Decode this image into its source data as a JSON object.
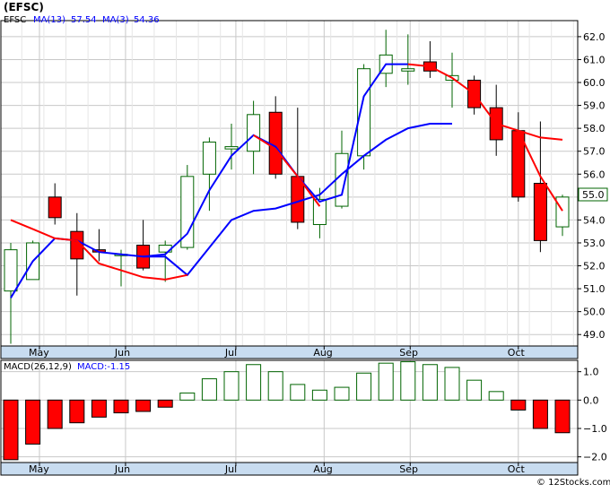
{
  "title": "(EFSC)",
  "watermark": "© 12Stocks.com",
  "colors": {
    "up": "#ffffff",
    "up_stroke": "#006400",
    "down": "#ff0000",
    "down_stroke": "#000000",
    "ma13": "#0000ff",
    "ma3": "#ff0000",
    "axis_band": "#c8dcf0",
    "macd_pos_stroke": "#006400",
    "macd_neg_fill": "#ff0000"
  },
  "price_legend": {
    "symbol": "EFSC",
    "ma13_label": "MA(13)",
    "ma13_value": "57.54",
    "ma3_label": "MA(3)",
    "ma3_value": "54.36"
  },
  "macd_legend": {
    "label": "MACD(26,12,9)",
    "value_label": "MACD:-1.15"
  },
  "last_price_label": "55.0",
  "chart_data": [
    {
      "type": "candlestick",
      "name": "price",
      "ylim": [
        48.5,
        62.7
      ],
      "yticks": [
        "49.0",
        "50.0",
        "51.0",
        "52.0",
        "53.0",
        "54.0",
        "55.0",
        "56.0",
        "57.0",
        "58.0",
        "59.0",
        "60.0",
        "61.0",
        "62.0"
      ],
      "months": [
        "May",
        "Jun",
        "Jul",
        "Aug",
        "Sep",
        "Oct"
      ],
      "month_index": [
        1.3,
        5.2,
        10.2,
        14.2,
        18.1,
        23.0
      ],
      "candles": [
        {
          "o": 50.9,
          "h": 53.0,
          "l": 48.6,
          "c": 52.7
        },
        {
          "o": 51.4,
          "h": 53.1,
          "l": 51.4,
          "c": 53.0
        },
        {
          "o": 55.0,
          "h": 55.6,
          "l": 53.8,
          "c": 54.1
        },
        {
          "o": 53.5,
          "h": 54.3,
          "l": 50.7,
          "c": 52.3
        },
        {
          "o": 52.7,
          "h": 53.6,
          "l": 52.2,
          "c": 52.6
        },
        {
          "o": 52.5,
          "h": 52.7,
          "l": 51.1,
          "c": 52.5
        },
        {
          "o": 52.9,
          "h": 54.0,
          "l": 51.8,
          "c": 51.9
        },
        {
          "o": 52.6,
          "h": 53.1,
          "l": 51.3,
          "c": 52.9
        },
        {
          "o": 52.8,
          "h": 56.4,
          "l": 52.7,
          "c": 55.9
        },
        {
          "o": 56.0,
          "h": 57.6,
          "l": 54.4,
          "c": 57.4
        },
        {
          "o": 57.1,
          "h": 58.2,
          "l": 56.2,
          "c": 57.2
        },
        {
          "o": 57.0,
          "h": 59.2,
          "l": 56.0,
          "c": 58.6
        },
        {
          "o": 58.7,
          "h": 59.4,
          "l": 55.8,
          "c": 56.0
        },
        {
          "o": 55.9,
          "h": 58.9,
          "l": 53.6,
          "c": 53.9
        },
        {
          "o": 53.8,
          "h": 55.4,
          "l": 53.2,
          "c": 54.9
        },
        {
          "o": 54.6,
          "h": 57.9,
          "l": 54.5,
          "c": 56.9
        },
        {
          "o": 56.8,
          "h": 60.8,
          "l": 56.2,
          "c": 60.6
        },
        {
          "o": 60.4,
          "h": 62.3,
          "l": 59.8,
          "c": 61.2
        },
        {
          "o": 60.5,
          "h": 62.1,
          "l": 59.9,
          "c": 60.6
        },
        {
          "o": 60.9,
          "h": 61.8,
          "l": 60.2,
          "c": 60.5
        },
        {
          "o": 60.1,
          "h": 61.3,
          "l": 58.9,
          "c": 60.3
        },
        {
          "o": 60.1,
          "h": 60.3,
          "l": 58.6,
          "c": 58.9
        },
        {
          "o": 58.9,
          "h": 59.9,
          "l": 56.8,
          "c": 57.5
        },
        {
          "o": 57.9,
          "h": 58.7,
          "l": 54.8,
          "c": 55.0
        },
        {
          "o": 55.6,
          "h": 58.3,
          "l": 52.6,
          "c": 53.1
        },
        {
          "o": 53.7,
          "h": 55.1,
          "l": 53.3,
          "c": 55.0
        }
      ],
      "ma13": [
        null,
        null,
        null,
        null,
        null,
        null,
        52.4,
        52.4,
        52.7,
        53.2,
        53.8,
        54.3,
        54.6,
        54.7,
        55.0,
        55.7,
        56.3,
        56.8,
        57.3,
        57.6,
        58.0,
        58.1,
        58.2,
        null,
        null,
        null
      ],
      "ma3": [
        null,
        null,
        null,
        null,
        null,
        null,
        null,
        null,
        null,
        null,
        null,
        null,
        null,
        null,
        null,
        null,
        null,
        null,
        null,
        null,
        null,
        null,
        null,
        null,
        null,
        null
      ],
      "ma13_series": [
        {
          "i": 0,
          "v": 50.7
        },
        {
          "i": 1,
          "v": 52.1
        },
        {
          "i": 2,
          "v": 53.2
        },
        {
          "i": 3,
          "v": 53.1
        },
        {
          "i": 4,
          "v": 52.6
        },
        {
          "i": 5,
          "v": 52.5
        },
        {
          "i": 6,
          "v": 52.4
        },
        {
          "i": 7,
          "v": 52.4
        },
        {
          "i": 8,
          "v": 52.9
        },
        {
          "i": 9,
          "v": 53.6
        },
        {
          "i": 10,
          "v": 54.5
        },
        {
          "i": 11,
          "v": 54.9
        },
        {
          "i": 12,
          "v": 55.0
        },
        {
          "i": 13,
          "v": 54.9
        },
        {
          "i": 14,
          "v": 55.1
        },
        {
          "i": 15,
          "v": 56.0
        },
        {
          "i": 16,
          "v": 57.0
        },
        {
          "i": 17,
          "v": 59.4
        },
        {
          "i": 18,
          "v": 60.8
        },
        {
          "i": 19,
          "v": 60.8
        }
      ],
      "ma13_line": [
        {
          "i": 6,
          "v": 52.35
        },
        {
          "i": 7,
          "v": 52.4
        },
        {
          "i": 8,
          "v": 52.6
        },
        {
          "i": 9,
          "v": 53.5
        },
        {
          "i": 10,
          "v": 54.1
        },
        {
          "i": 11,
          "v": 54.7
        },
        {
          "i": 12,
          "v": 54.8
        },
        {
          "i": 13,
          "v": 54.9
        },
        {
          "i": 14,
          "v": 55.1
        },
        {
          "i": 15,
          "v": 55.8
        },
        {
          "i": 16,
          "v": 56.5
        },
        {
          "i": 17,
          "v": 57.1
        },
        {
          "i": 18,
          "v": 57.5
        },
        {
          "i": 19,
          "v": 57.9
        },
        {
          "i": 20,
          "v": 58.1
        },
        {
          "i": 21,
          "v": 58.2
        },
        {
          "i": 22,
          "v": 58.2
        }
      ],
      "ma3_line": [
        {
          "i": 0,
          "v": 54.0
        },
        {
          "i": 1,
          "v": 53.6
        },
        {
          "i": 2,
          "v": 53.2
        },
        {
          "i": 3,
          "v": 53.1
        },
        {
          "i": 4,
          "v": 53.0
        },
        {
          "i": 5,
          "v": 52.6
        },
        {
          "i": 6,
          "v": 52.4
        },
        {
          "i": 7,
          "v": 52.3
        }
      ]
    },
    {
      "type": "bar",
      "name": "MACD",
      "ylim": [
        -2.2,
        1.4
      ],
      "yticks": [
        "1.0",
        "0.0",
        "−1.0",
        "−2.0"
      ],
      "ytick_values": [
        1.0,
        0.0,
        -1.0,
        -2.0
      ],
      "values": [
        -2.1,
        -1.55,
        -1.0,
        -0.8,
        -0.6,
        -0.45,
        -0.4,
        -0.25,
        0.25,
        0.75,
        1.0,
        1.25,
        1.0,
        0.55,
        0.35,
        0.45,
        0.95,
        1.3,
        1.35,
        1.25,
        1.15,
        0.7,
        0.3,
        -0.35,
        -1.0,
        -1.15
      ]
    }
  ]
}
